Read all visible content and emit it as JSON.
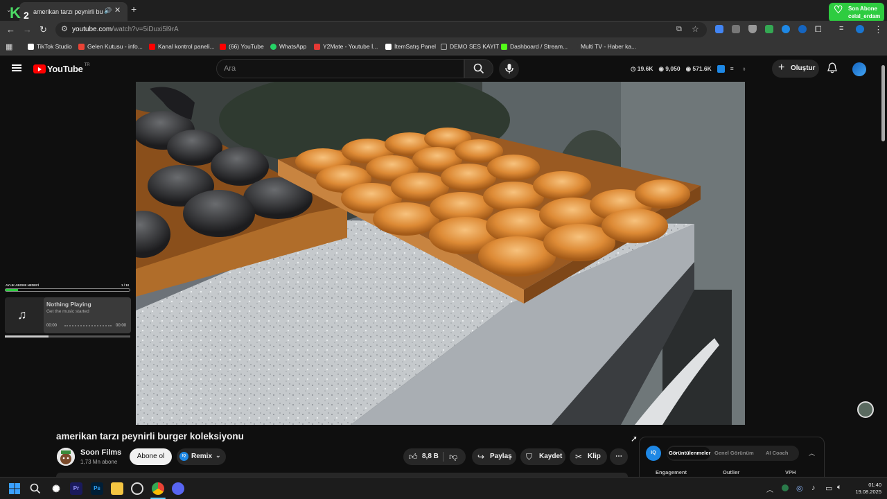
{
  "browser": {
    "tab_title": "amerikan tarzı peynirli burger koleksiyonu - YouTube",
    "url_host": "youtube.com",
    "url_path": "/watch?v=5iDuxi5l9rA",
    "logo_letter": "K",
    "logo_number": "2"
  },
  "son_abone": {
    "label": "Son Abone",
    "user": "celal_erdam"
  },
  "bookmarks": [
    {
      "label": "TikTok Studio",
      "color": "#ffffff"
    },
    {
      "label": "Gelen Kutusu - info...",
      "color": "#ea4335"
    },
    {
      "label": "Kanal kontrol paneli...",
      "color": "#ff0000"
    },
    {
      "label": "(66) YouTube",
      "color": "#ff0000"
    },
    {
      "label": "WhatsApp",
      "color": "#25d366"
    },
    {
      "label": "Y2Mate - Youtube İ...",
      "color": "#e53935"
    },
    {
      "label": "İtemSatış Panel",
      "color": "#ffffff"
    },
    {
      "label": "DEMO SES KAYIT",
      "color": "#aaaaaa"
    },
    {
      "label": "Dashboard / Stream...",
      "color": "#53fc18"
    },
    {
      "label": "Multi TV - Haber ka...",
      "color": "#353535"
    }
  ],
  "youtube": {
    "logo_text": "YouTube",
    "country": "TR",
    "search_placeholder": "Ara",
    "stats": [
      "19.6K",
      "9,050",
      "571.6K"
    ],
    "create_label": "Oluştur"
  },
  "music_widget": {
    "goal_label": "AYLIK ABONE HEDEFİ",
    "goal_count": "1 / 10",
    "goal_progress": 0.1,
    "title": "Nothing Playing",
    "subtitle": "Get the music started",
    "time_start": "00:00",
    "time_end": "00:00",
    "progress": 0.35
  },
  "video": {
    "title": "amerikan tarzı peynirli burger koleksiyonu",
    "channel": "Soon Films",
    "subscribers": "1,73 Mn abone",
    "subscribe_label": "Abone ol",
    "remix_label": "Remix",
    "likes": "8,8 B",
    "share_label": "Paylaş",
    "save_label": "Kaydet",
    "clip_label": "Klip",
    "more_label": "⋯"
  },
  "iq_panel": {
    "badge": "IQ",
    "tabs": [
      "Görüntülenmeler",
      "Genel Görünüm",
      "AI Coach"
    ],
    "columns": [
      "Engagement",
      "Outlier",
      "VPH"
    ]
  },
  "taskbar": {
    "time": "01:40",
    "date": "19.08.2025"
  },
  "colors": {
    "accent_green": "#2ecc40",
    "youtube_red": "#ff0000",
    "iq_blue": "#1e88e5"
  }
}
